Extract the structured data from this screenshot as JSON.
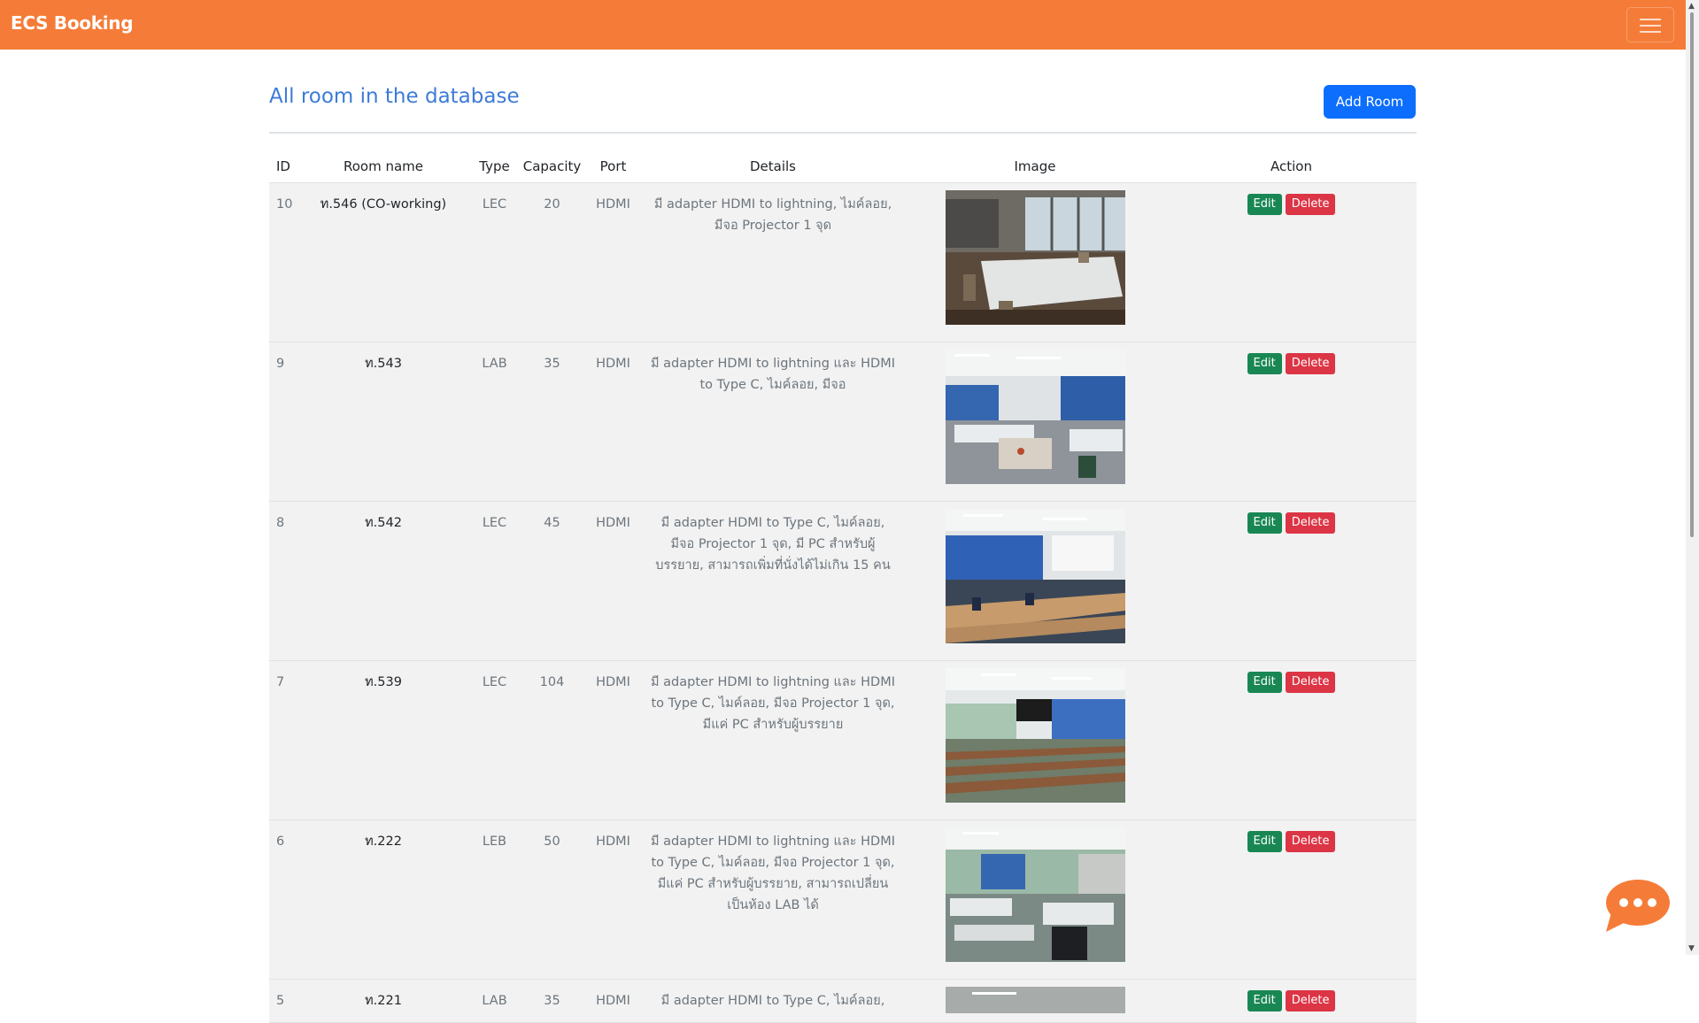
{
  "brand": "ECS Booking",
  "page_title": "All room in the database",
  "add_button": "Add Room",
  "table": {
    "headers": [
      "ID",
      "Room name",
      "Type",
      "Capacity",
      "Port",
      "Details",
      "Image",
      "Action"
    ],
    "rows": [
      {
        "id": "10",
        "name": "ท.546 (CO-working)",
        "type": "LEC",
        "capacity": "20",
        "port": "HDMI",
        "details": "มี adapter HDMI to lightning, ไมค์ลอย, มีจอ Projector 1 จุด",
        "edit": "Edit",
        "delete": "Delete"
      },
      {
        "id": "9",
        "name": "ท.543",
        "type": "LAB",
        "capacity": "35",
        "port": "HDMI",
        "details": "มี adapter HDMI to lightning และ HDMI to Type C, ไมค์ลอย, มีจอ",
        "edit": "Edit",
        "delete": "Delete"
      },
      {
        "id": "8",
        "name": "ท.542",
        "type": "LEC",
        "capacity": "45",
        "port": "HDMI",
        "details": "มี adapter HDMI to Type C, ไมค์ลอย, มีจอ Projector 1 จุด, มี PC สำหรับผู้บรรยาย, สามารถเพิ่มที่นั่งได้ไม่เกิน 15 คน",
        "edit": "Edit",
        "delete": "Delete"
      },
      {
        "id": "7",
        "name": "ท.539",
        "type": "LEC",
        "capacity": "104",
        "port": "HDMI",
        "details": "มี adapter HDMI to lightning และ HDMI to Type C, ไมค์ลอย, มีจอ Projector 1 จุด, มีแค่ PC สำหรับผู้บรรยาย",
        "edit": "Edit",
        "delete": "Delete"
      },
      {
        "id": "6",
        "name": "ท.222",
        "type": "LEB",
        "capacity": "50",
        "port": "HDMI",
        "details": "มี adapter HDMI to lightning และ HDMI to Type C, ไมค์ลอย, มีจอ Projector 1 จุด, มีแค่ PC สำหรับผู้บรรยาย, สามารถเปลี่ยนเป็นห้อง LAB ได้",
        "edit": "Edit",
        "delete": "Delete"
      },
      {
        "id": "5",
        "name": "ท.221",
        "type": "LAB",
        "capacity": "35",
        "port": "HDMI",
        "details": "มี adapter HDMI to Type C, ไมค์ลอย,",
        "edit": "Edit",
        "delete": "Delete"
      }
    ]
  },
  "icons": {
    "menu": "hamburger-menu-icon",
    "chat": "chat-bubble-icon"
  },
  "colors": {
    "navbar": "#f57c38",
    "primary": "#0d6efd",
    "success": "#198754",
    "danger": "#dc3545",
    "title": "#3d7bd9"
  }
}
